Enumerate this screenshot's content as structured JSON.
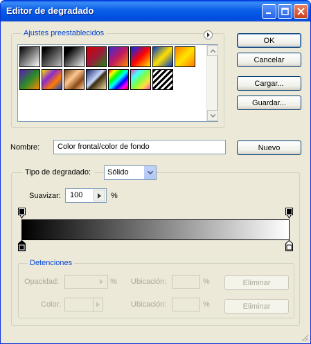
{
  "window": {
    "title": "Editor de degradado"
  },
  "presets": {
    "group_label": "Ajustes preestablecidos",
    "swatches": [
      {
        "name": "black-white",
        "css": "linear-gradient(135deg,#000 0%,#fff 100%)"
      },
      {
        "name": "black-transparent",
        "css": "linear-gradient(135deg,#000 10%,#bbb 100%)"
      },
      {
        "name": "black-white-transparent",
        "css": "linear-gradient(135deg,#000 20%,#eee 100%)"
      },
      {
        "name": "red-green",
        "css": "linear-gradient(135deg,#d40000 0%,#9c1a3a 50%,#1a8a1a 100%)"
      },
      {
        "name": "violet-orange",
        "css": "linear-gradient(135deg,#3b2bd6 0%,#c01860 50%,#ff8a00 100%)"
      },
      {
        "name": "blue-red-yellow",
        "css": "linear-gradient(135deg,#0028ff 0%,#ff0000 50%,#ffe800 100%)"
      },
      {
        "name": "blue-yellow-blue",
        "css": "linear-gradient(135deg,#0038c8 0%,#ffe000 50%,#0038c8 100%)"
      },
      {
        "name": "orange-yellow-orange",
        "css": "linear-gradient(135deg,#ff7a00 0%,#ffe400 50%,#ff7a00 100%)"
      },
      {
        "name": "violet-green-orange",
        "css": "linear-gradient(135deg,#5a1ab0 0%,#2a8a2a 50%,#ff8a00 100%)"
      },
      {
        "name": "yellow-violet-orange-blue",
        "css": "linear-gradient(135deg,#ffe000 0%,#8a2ad0 35%,#ff7a00 65%,#1a4ad0 100%)"
      },
      {
        "name": "copper",
        "css": "linear-gradient(135deg,#6a3a10 0%,#ffc890 40%,#8a4a18 70%,#ffd0a0 100%)"
      },
      {
        "name": "chrome",
        "css": "linear-gradient(135deg,#1a2a6a 0%,#c8d8ff 45%,#3a2a10 55%,#f0e0a0 100%)"
      },
      {
        "name": "spectrum",
        "css": "linear-gradient(135deg,#ff0000,#ffff00,#00ff00,#00ffff,#0000ff,#ff00ff,#ff0000)"
      },
      {
        "name": "transparent-rainbow",
        "css": "linear-gradient(135deg,#ff40c0,#40ffff,#80ff40,#ffe040,#ff40c0)"
      },
      {
        "name": "transparent-stripes",
        "css": "repeating-linear-gradient(135deg,#000 0px,#000 3px,#fff 3px,#fff 6px)"
      }
    ]
  },
  "buttons": {
    "ok": "OK",
    "cancel": "Cancelar",
    "load": "Cargar...",
    "save": "Guardar...",
    "new": "Nuevo"
  },
  "name_field": {
    "label": "Nombre:",
    "value": "Color frontal/color de fondo"
  },
  "gradient": {
    "type_label": "Tipo de degradado:",
    "type_value": "Sólido",
    "smoothness_label": "Suavizar:",
    "smoothness_value": "100",
    "smoothness_unit": "%",
    "start_color": "#000000",
    "end_color": "#ffffff"
  },
  "stops": {
    "group_label": "Detenciones",
    "opacity_label": "Opacidad:",
    "opacity_unit": "%",
    "color_label": "Color:",
    "location_label": "Ubicación:",
    "location_unit": "%",
    "delete_label": "Eliminar"
  }
}
